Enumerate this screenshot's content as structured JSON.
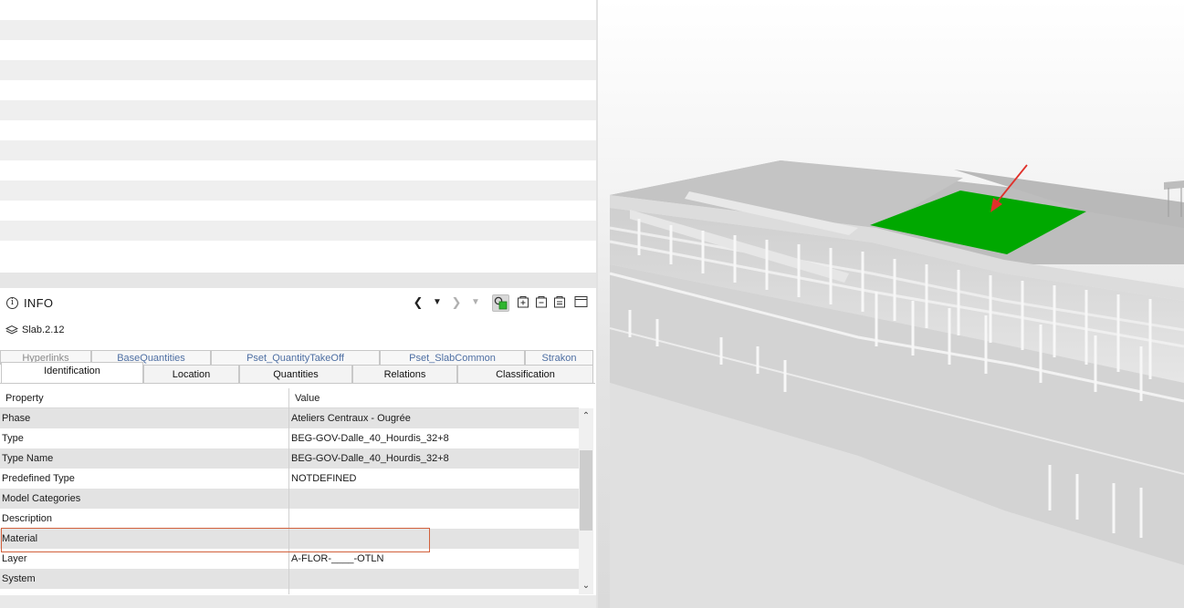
{
  "info_panel": {
    "title": "INFO",
    "info_icon_glyph": "i",
    "object_name": "Slab.2.12",
    "toolbar": {
      "back_glyph": "❮",
      "back_dropdown_glyph": "▼",
      "forward_glyph": "❯",
      "forward_dropdown_glyph": "▼"
    }
  },
  "tabs": {
    "back_row": [
      "Hyperlinks",
      "BaseQuantities",
      "Pset_QuantityTakeOff",
      "Pset_SlabCommon",
      "Strakon"
    ],
    "front_row": [
      "Identification",
      "Location",
      "Quantities",
      "Relations",
      "Classification"
    ],
    "active": "Identification"
  },
  "table": {
    "headers": {
      "property": "Property",
      "value": "Value"
    },
    "rows": [
      {
        "property": "Phase",
        "value": "Ateliers Centraux - Ougrée"
      },
      {
        "property": "Type",
        "value": "BEG-GOV-Dalle_40_Hourdis_32+8"
      },
      {
        "property": "Type Name",
        "value": "BEG-GOV-Dalle_40_Hourdis_32+8"
      },
      {
        "property": "Predefined Type",
        "value": "NOTDEFINED"
      },
      {
        "property": "Model Categories",
        "value": ""
      },
      {
        "property": "Description",
        "value": ""
      },
      {
        "property": "Material",
        "value": ""
      },
      {
        "property": "Layer",
        "value": "A-FLOR-____-OTLN"
      },
      {
        "property": "System",
        "value": ""
      }
    ],
    "highlighted_row": "Material"
  },
  "scrollbar": {
    "up_glyph": "⌃",
    "down_glyph": "⌄"
  },
  "viewport": {
    "selected_color": "#00a800",
    "arrow_color": "#e0312b",
    "highlight_box_color": "#d2603c"
  }
}
